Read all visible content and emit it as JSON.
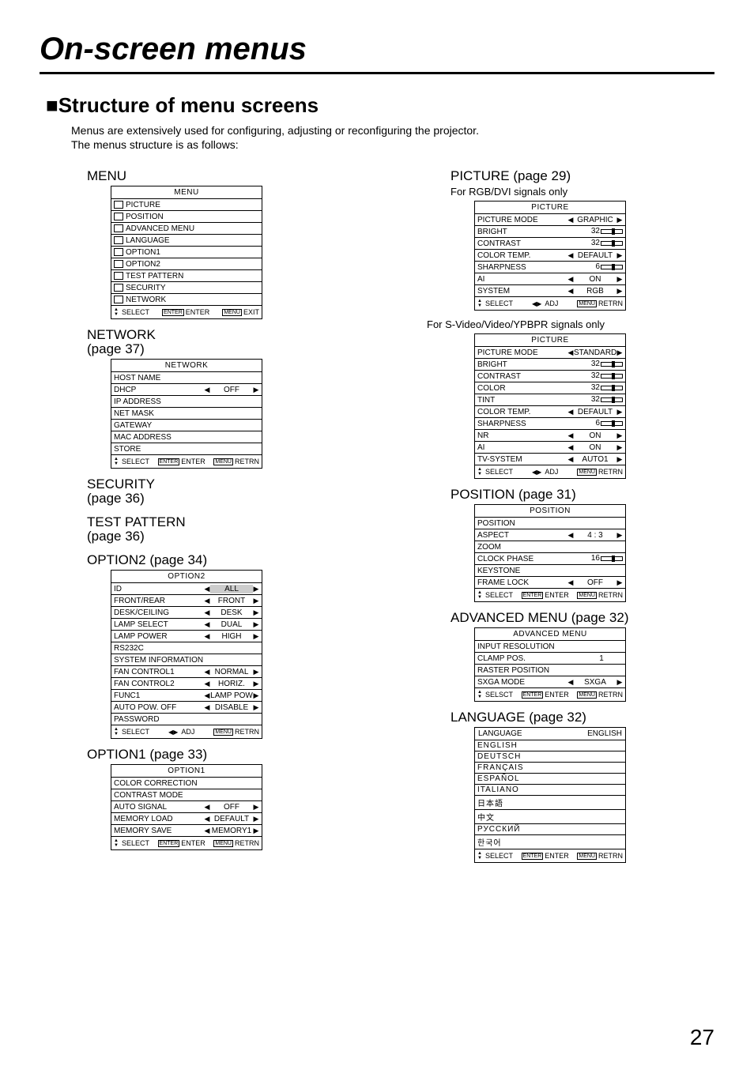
{
  "page": {
    "title": "On-screen menus",
    "section": "■Structure of menu screens",
    "intro1": "Menus are extensively used for configuring, adjusting or reconfiguring the projector.",
    "intro2": "The menus structure is as follows:",
    "pagenum": "27"
  },
  "labels": {
    "menu": "MENU",
    "network": "NETWORK",
    "network_page": "(page 37)",
    "security": "SECURITY",
    "security_page": "(page 36)",
    "testpattern": "TEST PATTERN",
    "testpattern_page": "(page 36)",
    "option2": "OPTION2 (page 34)",
    "option1": "OPTION1 (page 33)",
    "picture": "PICTURE (page 29)",
    "picture_rgb": "For RGB/DVI signals only",
    "picture_svideo": "For S-Video/Video/YPBPR signals only",
    "position": "POSITION (page 31)",
    "advanced": "ADVANCED MENU (page 32)",
    "language": "LANGUAGE (page 32)"
  },
  "osd": {
    "menu": {
      "title": "MENU",
      "items": [
        "PICTURE",
        "POSITION",
        "ADVANCED MENU",
        "LANGUAGE",
        "OPTION1",
        "OPTION2",
        "TEST PATTERN",
        "SECURITY",
        "NETWORK"
      ],
      "footer": {
        "left": "SELECT",
        "mid": "ENTER",
        "right": "EXIT",
        "midtag": "ENTER",
        "righttag": "MENU"
      }
    },
    "network": {
      "title": "NETWORK",
      "rows": [
        {
          "label": "HOST NAME"
        },
        {
          "label": "DHCP",
          "val": "OFF",
          "arrows": true
        },
        {
          "label": "IP ADDRESS"
        },
        {
          "label": "NET MASK"
        },
        {
          "label": "GATEWAY"
        },
        {
          "label": "MAC ADDRESS"
        },
        {
          "label": "STORE"
        }
      ],
      "footer": {
        "left": "SELECT",
        "mid": "ENTER",
        "right": "RETRN",
        "midtag": "ENTER",
        "righttag": "MENU"
      }
    },
    "option2": {
      "title": "OPTION2",
      "rows": [
        {
          "label": "ID",
          "val": "ALL",
          "arrows": true,
          "hl": true
        },
        {
          "label": "FRONT/REAR",
          "val": "FRONT",
          "arrows": true
        },
        {
          "label": "DESK/CEILING",
          "val": "DESK",
          "arrows": true
        },
        {
          "label": "LAMP SELECT",
          "val": "DUAL",
          "arrows": true
        },
        {
          "label": "LAMP POWER",
          "val": "HIGH",
          "arrows": true
        },
        {
          "label": "RS232C"
        },
        {
          "label": "SYSTEM INFORMATION"
        },
        {
          "label": "FAN CONTROL1",
          "val": "NORMAL",
          "arrows": true
        },
        {
          "label": "FAN CONTROL2",
          "val": "HORIZ.",
          "arrows": true
        },
        {
          "label": "FUNC1",
          "val": "LAMP POW",
          "arrows": true
        },
        {
          "label": "AUTO POW. OFF",
          "val": "DISABLE",
          "arrows": true
        },
        {
          "label": "PASSWORD"
        }
      ],
      "footer": {
        "left": "SELECT",
        "mid": "ADJ",
        "right": "RETRN",
        "midicon": "lr",
        "righttag": "MENU"
      }
    },
    "option1": {
      "title": "OPTION1",
      "rows": [
        {
          "label": "COLOR CORRECTION"
        },
        {
          "label": "CONTRAST MODE"
        },
        {
          "label": "AUTO SIGNAL",
          "val": "OFF",
          "arrows": true
        },
        {
          "label": "MEMORY LOAD",
          "val": "DEFAULT",
          "arrows": true
        },
        {
          "label": "MEMORY SAVE",
          "val": "MEMORY1",
          "arrows": true
        }
      ],
      "footer": {
        "left": "SELECT",
        "mid": "ENTER",
        "right": "RETRN",
        "midtag": "ENTER",
        "righttag": "MENU"
      }
    },
    "picture_rgb": {
      "title": "PICTURE",
      "rows": [
        {
          "label": "PICTURE MODE",
          "val": "GRAPHIC",
          "arrows": true
        },
        {
          "label": "BRIGHT",
          "val": "32",
          "slider": true
        },
        {
          "label": "CONTRAST",
          "val": "32",
          "slider": true
        },
        {
          "label": "COLOR TEMP.",
          "val": "DEFAULT",
          "arrows": true
        },
        {
          "label": "SHARPNESS",
          "val": "6",
          "slider": true
        },
        {
          "label": "AI",
          "val": "ON",
          "arrows": true
        },
        {
          "label": "SYSTEM",
          "val": "RGB",
          "arrows": true
        }
      ],
      "footer": {
        "left": "SELECT",
        "mid": "ADJ",
        "right": "RETRN",
        "midicon": "lr",
        "righttag": "MENU"
      }
    },
    "picture_sv": {
      "title": "PICTURE",
      "rows": [
        {
          "label": "PICTURE MODE",
          "val": "STANDARD",
          "arrows": true
        },
        {
          "label": "BRIGHT",
          "val": "32",
          "slider": true
        },
        {
          "label": "CONTRAST",
          "val": "32",
          "slider": true
        },
        {
          "label": "COLOR",
          "val": "32",
          "slider": true
        },
        {
          "label": "TINT",
          "val": "32",
          "slider": true
        },
        {
          "label": "COLOR TEMP.",
          "val": "DEFAULT",
          "arrows": true
        },
        {
          "label": "SHARPNESS",
          "val": "6",
          "slider": true
        },
        {
          "label": "NR",
          "val": "ON",
          "arrows": true
        },
        {
          "label": "AI",
          "val": "ON",
          "arrows": true
        },
        {
          "label": "TV-SYSTEM",
          "val": "AUTO1",
          "arrows": true
        }
      ],
      "footer": {
        "left": "SELECT",
        "mid": "ADJ",
        "right": "RETRN",
        "midicon": "lr",
        "righttag": "MENU"
      }
    },
    "position": {
      "title": "POSITION",
      "rows": [
        {
          "label": "POSITION"
        },
        {
          "label": "ASPECT",
          "val": "4 : 3",
          "arrows": true
        },
        {
          "label": "ZOOM"
        },
        {
          "label": "CLOCK PHASE",
          "val": "16",
          "slider": true
        },
        {
          "label": "KEYSTONE"
        },
        {
          "label": "FRAME LOCK",
          "val": "OFF",
          "arrows": true
        }
      ],
      "footer": {
        "left": "SELECT",
        "mid": "ENTER",
        "right": "RETRN",
        "midtag": "ENTER",
        "righttag": "MENU"
      }
    },
    "advanced": {
      "title": "ADVANCED MENU",
      "rows": [
        {
          "label": "INPUT RESOLUTION"
        },
        {
          "label": "CLAMP POS.",
          "val": "1"
        },
        {
          "label": "RASTER POSITION"
        },
        {
          "label": "SXGA MODE",
          "val": "SXGA",
          "arrows": true
        }
      ],
      "footer": {
        "left": "SELSCT",
        "mid": "ENTER",
        "right": "RETRN",
        "midtag": "ENTER",
        "righttag": "MENU"
      }
    },
    "language": {
      "title": "LANGUAGE",
      "current": "ENGLISH",
      "items": [
        "ENGLISH",
        "DEUTSCH",
        "FRANÇAIS",
        "ESPAÑOL",
        "ITALIANO",
        "日本語",
        "中文",
        "РУССКИЙ",
        "한국어"
      ],
      "footer": {
        "left": "SELECT",
        "mid": "ENTER",
        "right": "RETRN",
        "midtag": "ENTER",
        "righttag": "MENU"
      }
    }
  }
}
